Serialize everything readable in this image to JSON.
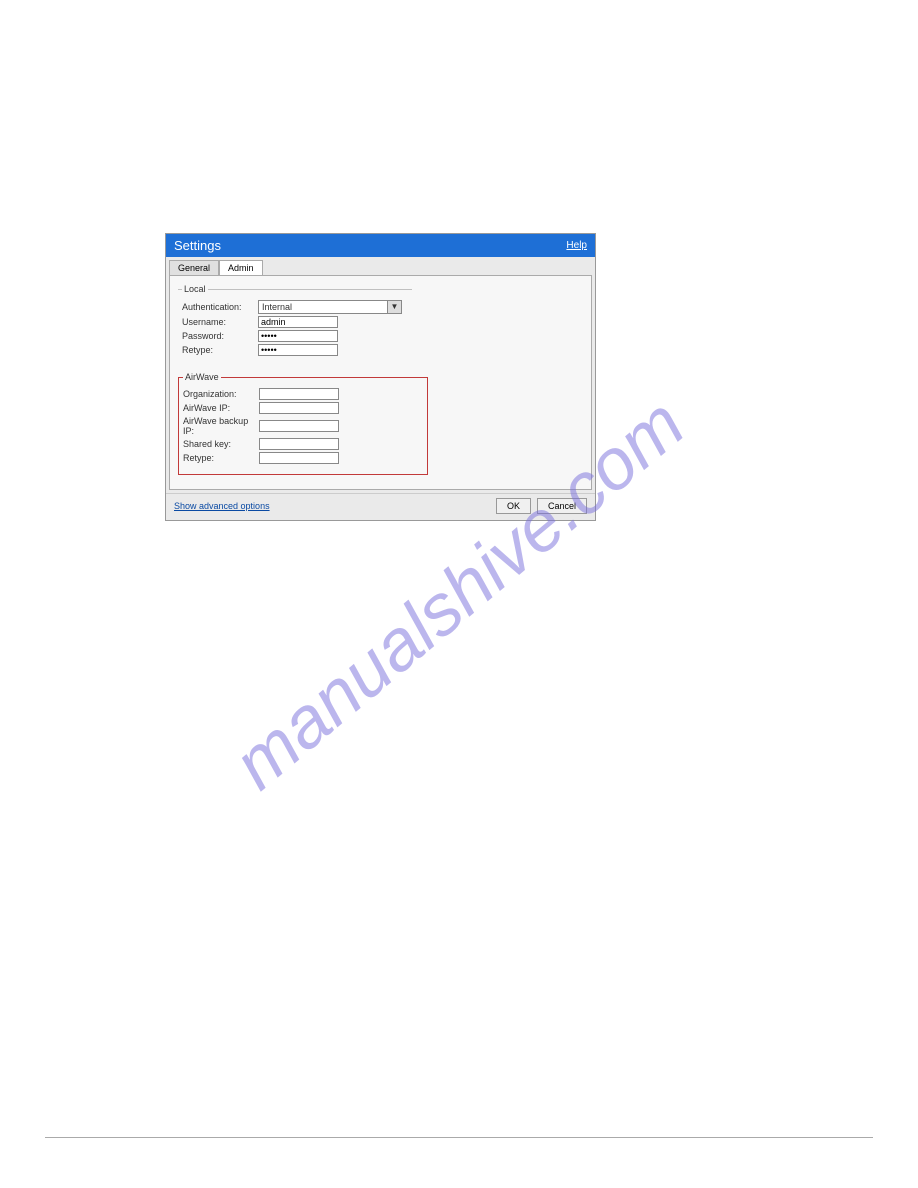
{
  "dialog": {
    "title": "Settings",
    "help_label": "Help",
    "tabs": {
      "general": "General",
      "admin": "Admin"
    },
    "local": {
      "legend": "Local",
      "authentication": {
        "label": "Authentication:",
        "value": "Internal"
      },
      "username": {
        "label": "Username:",
        "value": "admin"
      },
      "password": {
        "label": "Password:",
        "value": "•••••"
      },
      "retype": {
        "label": "Retype:",
        "value": "•••••"
      }
    },
    "airwave": {
      "legend": "AirWave",
      "organization": {
        "label": "Organization:",
        "value": ""
      },
      "airwave_ip": {
        "label": "AirWave IP:",
        "value": ""
      },
      "airwave_backup_ip": {
        "label": "AirWave backup IP:",
        "value": ""
      },
      "shared_key": {
        "label": "Shared key:",
        "value": ""
      },
      "retype": {
        "label": "Retype:",
        "value": ""
      }
    },
    "advanced_link": "Show advanced options",
    "buttons": {
      "ok": "OK",
      "cancel": "Cancel"
    }
  },
  "watermark": "manualshive.com"
}
